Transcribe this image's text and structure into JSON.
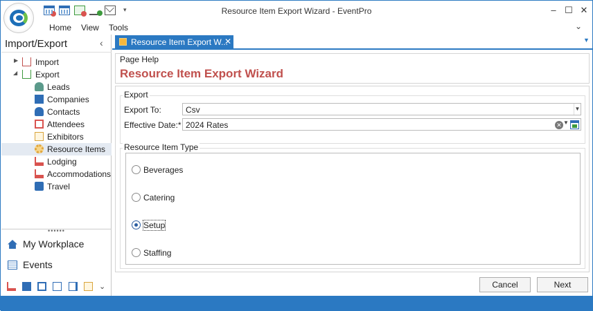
{
  "window": {
    "title": "Resource Item Export Wizard - EventPro",
    "menu": [
      "Home",
      "View",
      "Tools"
    ]
  },
  "nav": {
    "title": "Import/Export",
    "tree": [
      {
        "label": "Import",
        "level": 0,
        "expanded": false
      },
      {
        "label": "Export",
        "level": 0,
        "expanded": true
      },
      {
        "label": "Leads",
        "level": 1,
        "icon": "person-icon"
      },
      {
        "label": "Companies",
        "level": 1,
        "icon": "factory-icon"
      },
      {
        "label": "Contacts",
        "level": 1,
        "icon": "person-icon"
      },
      {
        "label": "Attendees",
        "level": 1,
        "icon": "badge-icon"
      },
      {
        "label": "Exhibitors",
        "level": 1,
        "icon": "card-icon"
      },
      {
        "label": "Resource Items",
        "level": 1,
        "icon": "gear-icon",
        "selected": true
      },
      {
        "label": "Lodging",
        "level": 1,
        "icon": "bed-icon"
      },
      {
        "label": "Accommodations",
        "level": 1,
        "icon": "bed-icon"
      },
      {
        "label": "Travel",
        "level": 1,
        "icon": "suitcase-icon"
      }
    ],
    "buttons": [
      "My Workplace",
      "Events"
    ]
  },
  "tab": {
    "label": "Resource Item Export W..."
  },
  "page_help": {
    "group_label": "Page Help",
    "title": "Resource Item Export Wizard"
  },
  "export_group": {
    "label": "Export",
    "export_to_label": "Export To:",
    "export_to_value": "Csv",
    "effective_date_label": "Effective Date:*",
    "effective_date_value": "2024 Rates"
  },
  "type_group": {
    "label": "Resource Item Type",
    "options": [
      {
        "label": "Beverages",
        "selected": false
      },
      {
        "label": "Catering",
        "selected": false
      },
      {
        "label": "Setup",
        "selected": true
      },
      {
        "label": "Staffing",
        "selected": false
      }
    ]
  },
  "footer": {
    "cancel": "Cancel",
    "next": "Next"
  },
  "colors": {
    "accent": "#2b79c2",
    "title_red": "#c0504d"
  }
}
